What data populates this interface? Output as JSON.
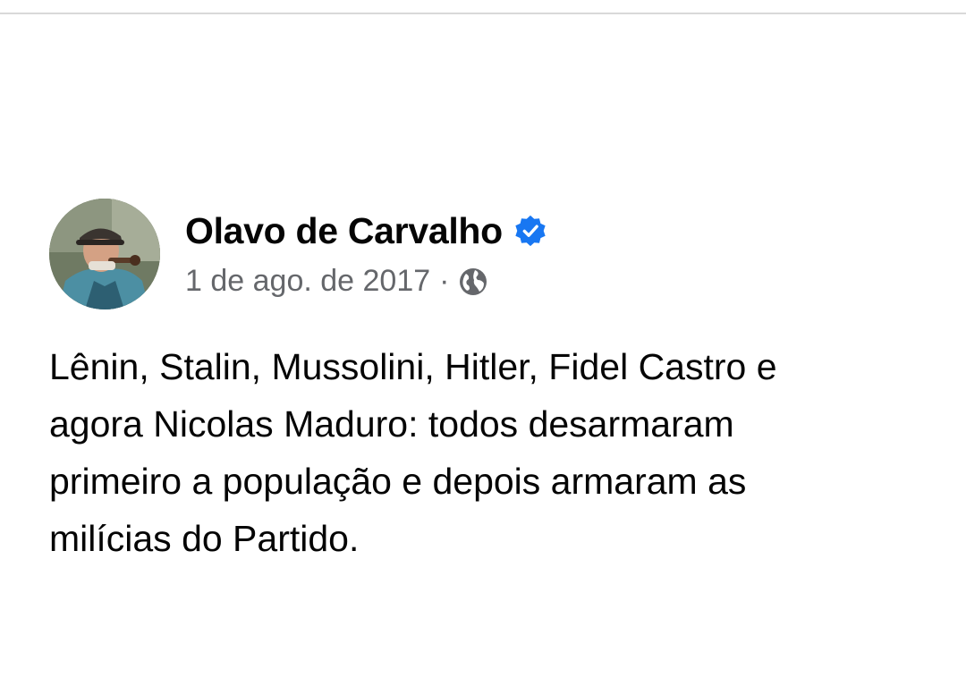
{
  "post": {
    "author": "Olavo de Carvalho",
    "date": "1 de ago. de 2017",
    "separator": "·",
    "audience_icon": "globe-icon",
    "verified_icon": "verified-badge-icon",
    "text_lines": [
      "Lênin, Stalin, Mussolini, Hitler, Fidel Castro e",
      "agora Nicolas Maduro: todos desarmaram",
      "primeiro a população e depois armaram as",
      "milícias do Partido."
    ]
  },
  "colors": {
    "name": "#050505",
    "meta": "#65676b",
    "verified": "#1877f2",
    "background": "#ffffff"
  }
}
